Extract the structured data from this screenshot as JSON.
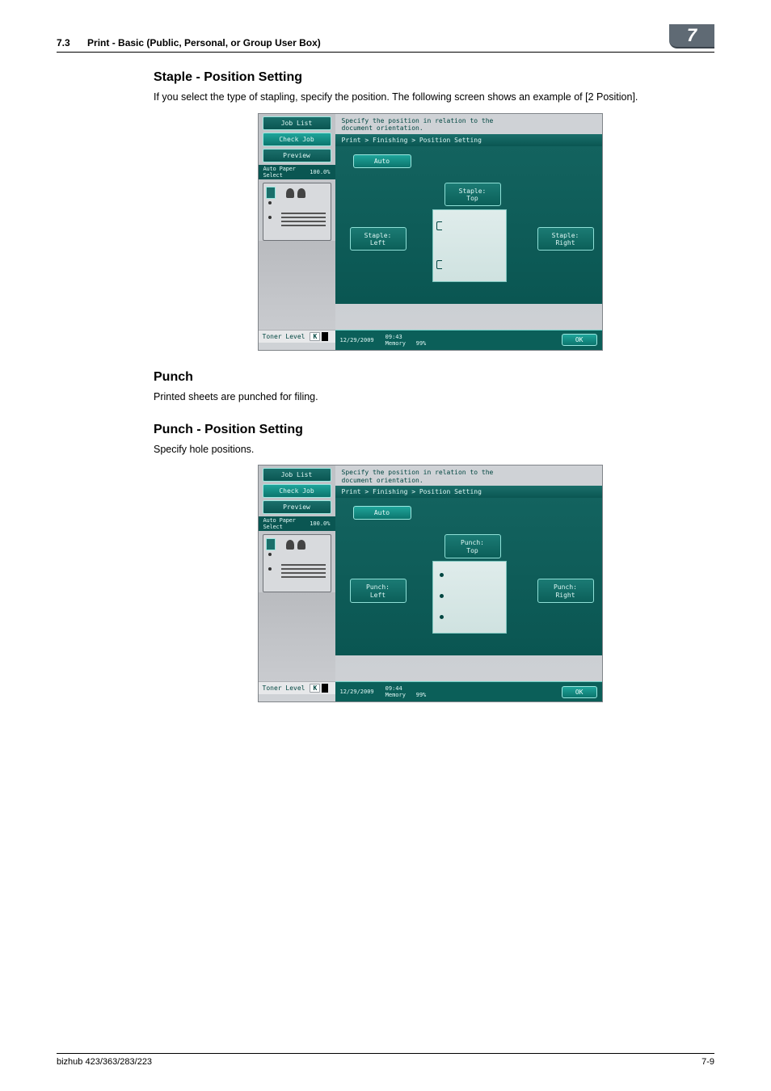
{
  "header": {
    "section_number": "7.3",
    "section_title": "Print - Basic (Public, Personal, or Group User Box)",
    "chapter_badge": "7"
  },
  "sections": {
    "staple": {
      "title": "Staple - Position Setting",
      "body": "If you select the type of stapling, specify the position. The following screen shows an example of [2 Position]."
    },
    "punch": {
      "title": "Punch",
      "body": "Printed sheets are punched for filing."
    },
    "punch_pos": {
      "title": "Punch - Position Setting",
      "body": "Specify hole positions."
    }
  },
  "panel_common": {
    "job_list": "Job List",
    "check_job": "Check Job",
    "preview": "Preview",
    "auto_paper": "Auto Paper\nSelect",
    "zoom": "100.0%",
    "toner_label": "Toner Level",
    "toner_k": "K",
    "instruction": "Specify the position in relation to the\ndocument orientation.",
    "breadcrumb": "Print > Finishing > Position Setting",
    "auto": "Auto",
    "ok": "OK",
    "memory": "Memory",
    "mem_pct": "99%"
  },
  "panel_staple": {
    "top": "Staple:\nTop",
    "left": "Staple:\nLeft",
    "right": "Staple:\nRight",
    "date": "12/29/2009",
    "time": "09:43"
  },
  "panel_punch": {
    "top": "Punch:\nTop",
    "left": "Punch:\nLeft",
    "right": "Punch:\nRight",
    "date": "12/29/2009",
    "time": "09:44"
  },
  "footer": {
    "model": "bizhub 423/363/283/223",
    "page": "7-9"
  }
}
